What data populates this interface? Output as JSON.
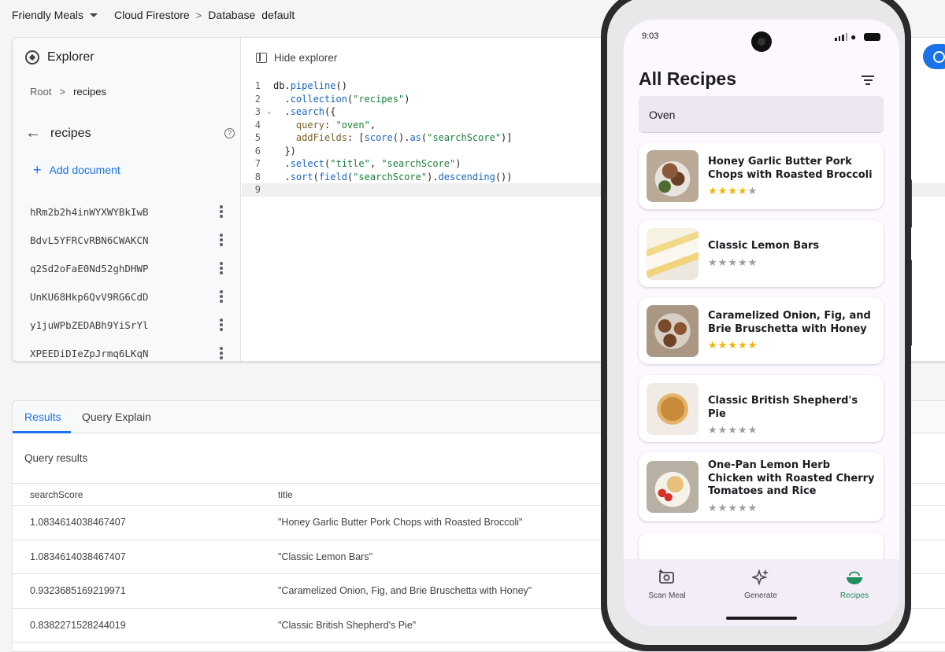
{
  "topbar": {
    "project": "Friendly Meals",
    "crumbs": [
      "Cloud Firestore",
      "Database",
      "default"
    ]
  },
  "explorer": {
    "title": "Explorer",
    "root_crumb": "Root",
    "current_crumb": "recipes",
    "collection": "recipes",
    "add_document": "Add document",
    "documents": [
      "hRm2b2h4inWYXWYBkIwB",
      "BdvL5YFRCvRBN6CWAKCN",
      "q2Sd2oFaE0Nd52ghDHWP",
      "UnKU68Hkp6QvV9RG6CdD",
      "y1juWPbZEDABh9YiSrYl",
      "XPEEDiDIeZpJrmq6LKqN"
    ]
  },
  "editor": {
    "hide_explorer": "Hide explorer",
    "lines": [
      {
        "num": "1",
        "tokens": [
          [
            "plain",
            "db."
          ],
          [
            "fn",
            "pipeline"
          ],
          [
            "plain",
            "()"
          ]
        ]
      },
      {
        "num": "2",
        "tokens": [
          [
            "plain",
            "  ."
          ],
          [
            "fn",
            "collection"
          ],
          [
            "plain",
            "("
          ],
          [
            "str",
            "\"recipes\""
          ],
          [
            "plain",
            ")"
          ]
        ]
      },
      {
        "num": "3",
        "fold": true,
        "tokens": [
          [
            "plain",
            "  ."
          ],
          [
            "fn",
            "search"
          ],
          [
            "plain",
            "({"
          ]
        ]
      },
      {
        "num": "4",
        "tokens": [
          [
            "plain",
            "    "
          ],
          [
            "key",
            "query"
          ],
          [
            "plain",
            ": "
          ],
          [
            "str",
            "\"oven\""
          ],
          [
            "plain",
            ","
          ]
        ]
      },
      {
        "num": "5",
        "tokens": [
          [
            "plain",
            "    "
          ],
          [
            "key",
            "addFields"
          ],
          [
            "plain",
            ": ["
          ],
          [
            "fn",
            "score"
          ],
          [
            "plain",
            "()."
          ],
          [
            "fn",
            "as"
          ],
          [
            "plain",
            "("
          ],
          [
            "str",
            "\"searchScore\""
          ],
          [
            "plain",
            ")]"
          ]
        ]
      },
      {
        "num": "6",
        "tokens": [
          [
            "plain",
            "  })"
          ]
        ]
      },
      {
        "num": "7",
        "tokens": [
          [
            "plain",
            "  ."
          ],
          [
            "fn",
            "select"
          ],
          [
            "plain",
            "("
          ],
          [
            "str",
            "\"title\""
          ],
          [
            "plain",
            ", "
          ],
          [
            "str",
            "\"searchScore\""
          ],
          [
            "plain",
            ")"
          ]
        ]
      },
      {
        "num": "8",
        "tokens": [
          [
            "plain",
            "  ."
          ],
          [
            "fn",
            "sort"
          ],
          [
            "plain",
            "("
          ],
          [
            "fn",
            "field"
          ],
          [
            "plain",
            "("
          ],
          [
            "str",
            "\"searchScore\""
          ],
          [
            "plain",
            ")."
          ],
          [
            "fn",
            "descending"
          ],
          [
            "plain",
            "())"
          ]
        ]
      },
      {
        "num": "9",
        "active": true,
        "tokens": []
      }
    ]
  },
  "results": {
    "tabs": [
      "Results",
      "Query Explain"
    ],
    "heading": "Query results",
    "columns": [
      "searchScore",
      "title"
    ],
    "rows": [
      [
        "1.0834614038467407",
        "\"Honey Garlic Butter Pork Chops with Roasted Broccoli\""
      ],
      [
        "1.0834614038467407",
        "\"Classic Lemon Bars\""
      ],
      [
        "0.9323685169219971",
        "\"Caramelized Onion, Fig, and Brie Bruschetta with Honey\""
      ],
      [
        "0.8382271528244019",
        "\"Classic British Shepherd's Pie\""
      ]
    ]
  },
  "phone": {
    "time": "9:03",
    "title": "All Recipes",
    "search_value": "Oven",
    "recipes": [
      {
        "title": "Honey Garlic Butter Pork Chops with Roasted Broccoli",
        "rating": 4,
        "max": 5
      },
      {
        "title": "Classic Lemon Bars",
        "rating": 0,
        "max": 5
      },
      {
        "title": "Caramelized Onion, Fig, and Brie Bruschetta with Honey",
        "rating": 5,
        "max": 5
      },
      {
        "title": "Classic British Shepherd's Pie",
        "rating": 0,
        "max": 5
      },
      {
        "title": "One-Pan Lemon Herb Chicken with Roasted Cherry Tomatoes and Rice",
        "rating": 0,
        "max": 5
      }
    ],
    "nav": [
      {
        "label": "Scan Meal",
        "icon": "camera-plus-icon",
        "active": false
      },
      {
        "label": "Generate",
        "icon": "sparkle-icon",
        "active": false
      },
      {
        "label": "Recipes",
        "icon": "bowl-icon",
        "active": true
      }
    ],
    "colors": {
      "star": "#f4b400",
      "accent": "#1e8e5a",
      "screen_bg": "#fdf7ff"
    }
  }
}
